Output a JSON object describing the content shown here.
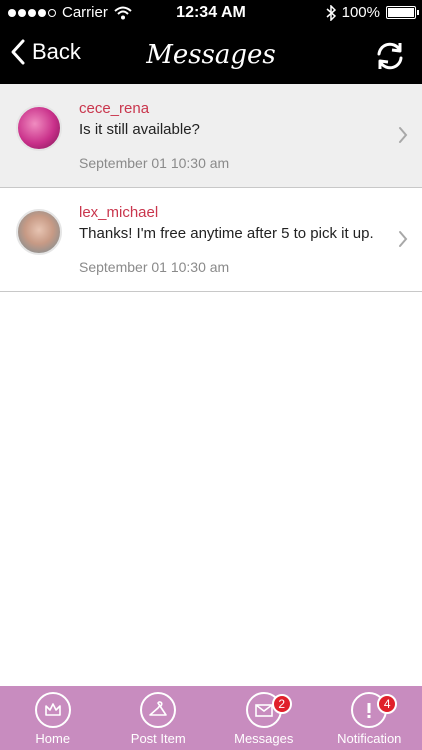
{
  "status_bar": {
    "carrier": "Carrier",
    "time": "12:34 AM",
    "battery": "100%"
  },
  "nav": {
    "back_label": "Back",
    "title": "Messages"
  },
  "messages": [
    {
      "username": "cece_rena",
      "text": "Is it still available?",
      "timestamp": "September 01 10:30 am"
    },
    {
      "username": "lex_michael",
      "text": "Thanks! I'm free anytime after 5 to pick it up.",
      "timestamp": "September 01 10:30 am"
    }
  ],
  "tabs": [
    {
      "label": "Home",
      "icon": "crown-icon"
    },
    {
      "label": "Post Item",
      "icon": "hanger-icon"
    },
    {
      "label": "Messages",
      "icon": "envelope-icon",
      "badge": "2"
    },
    {
      "label": "Notification",
      "icon": "exclamation-icon",
      "badge": "4"
    }
  ],
  "colors": {
    "tab_bar": "#c88cbf",
    "username": "#c9364d",
    "badge": "#e0202a"
  }
}
